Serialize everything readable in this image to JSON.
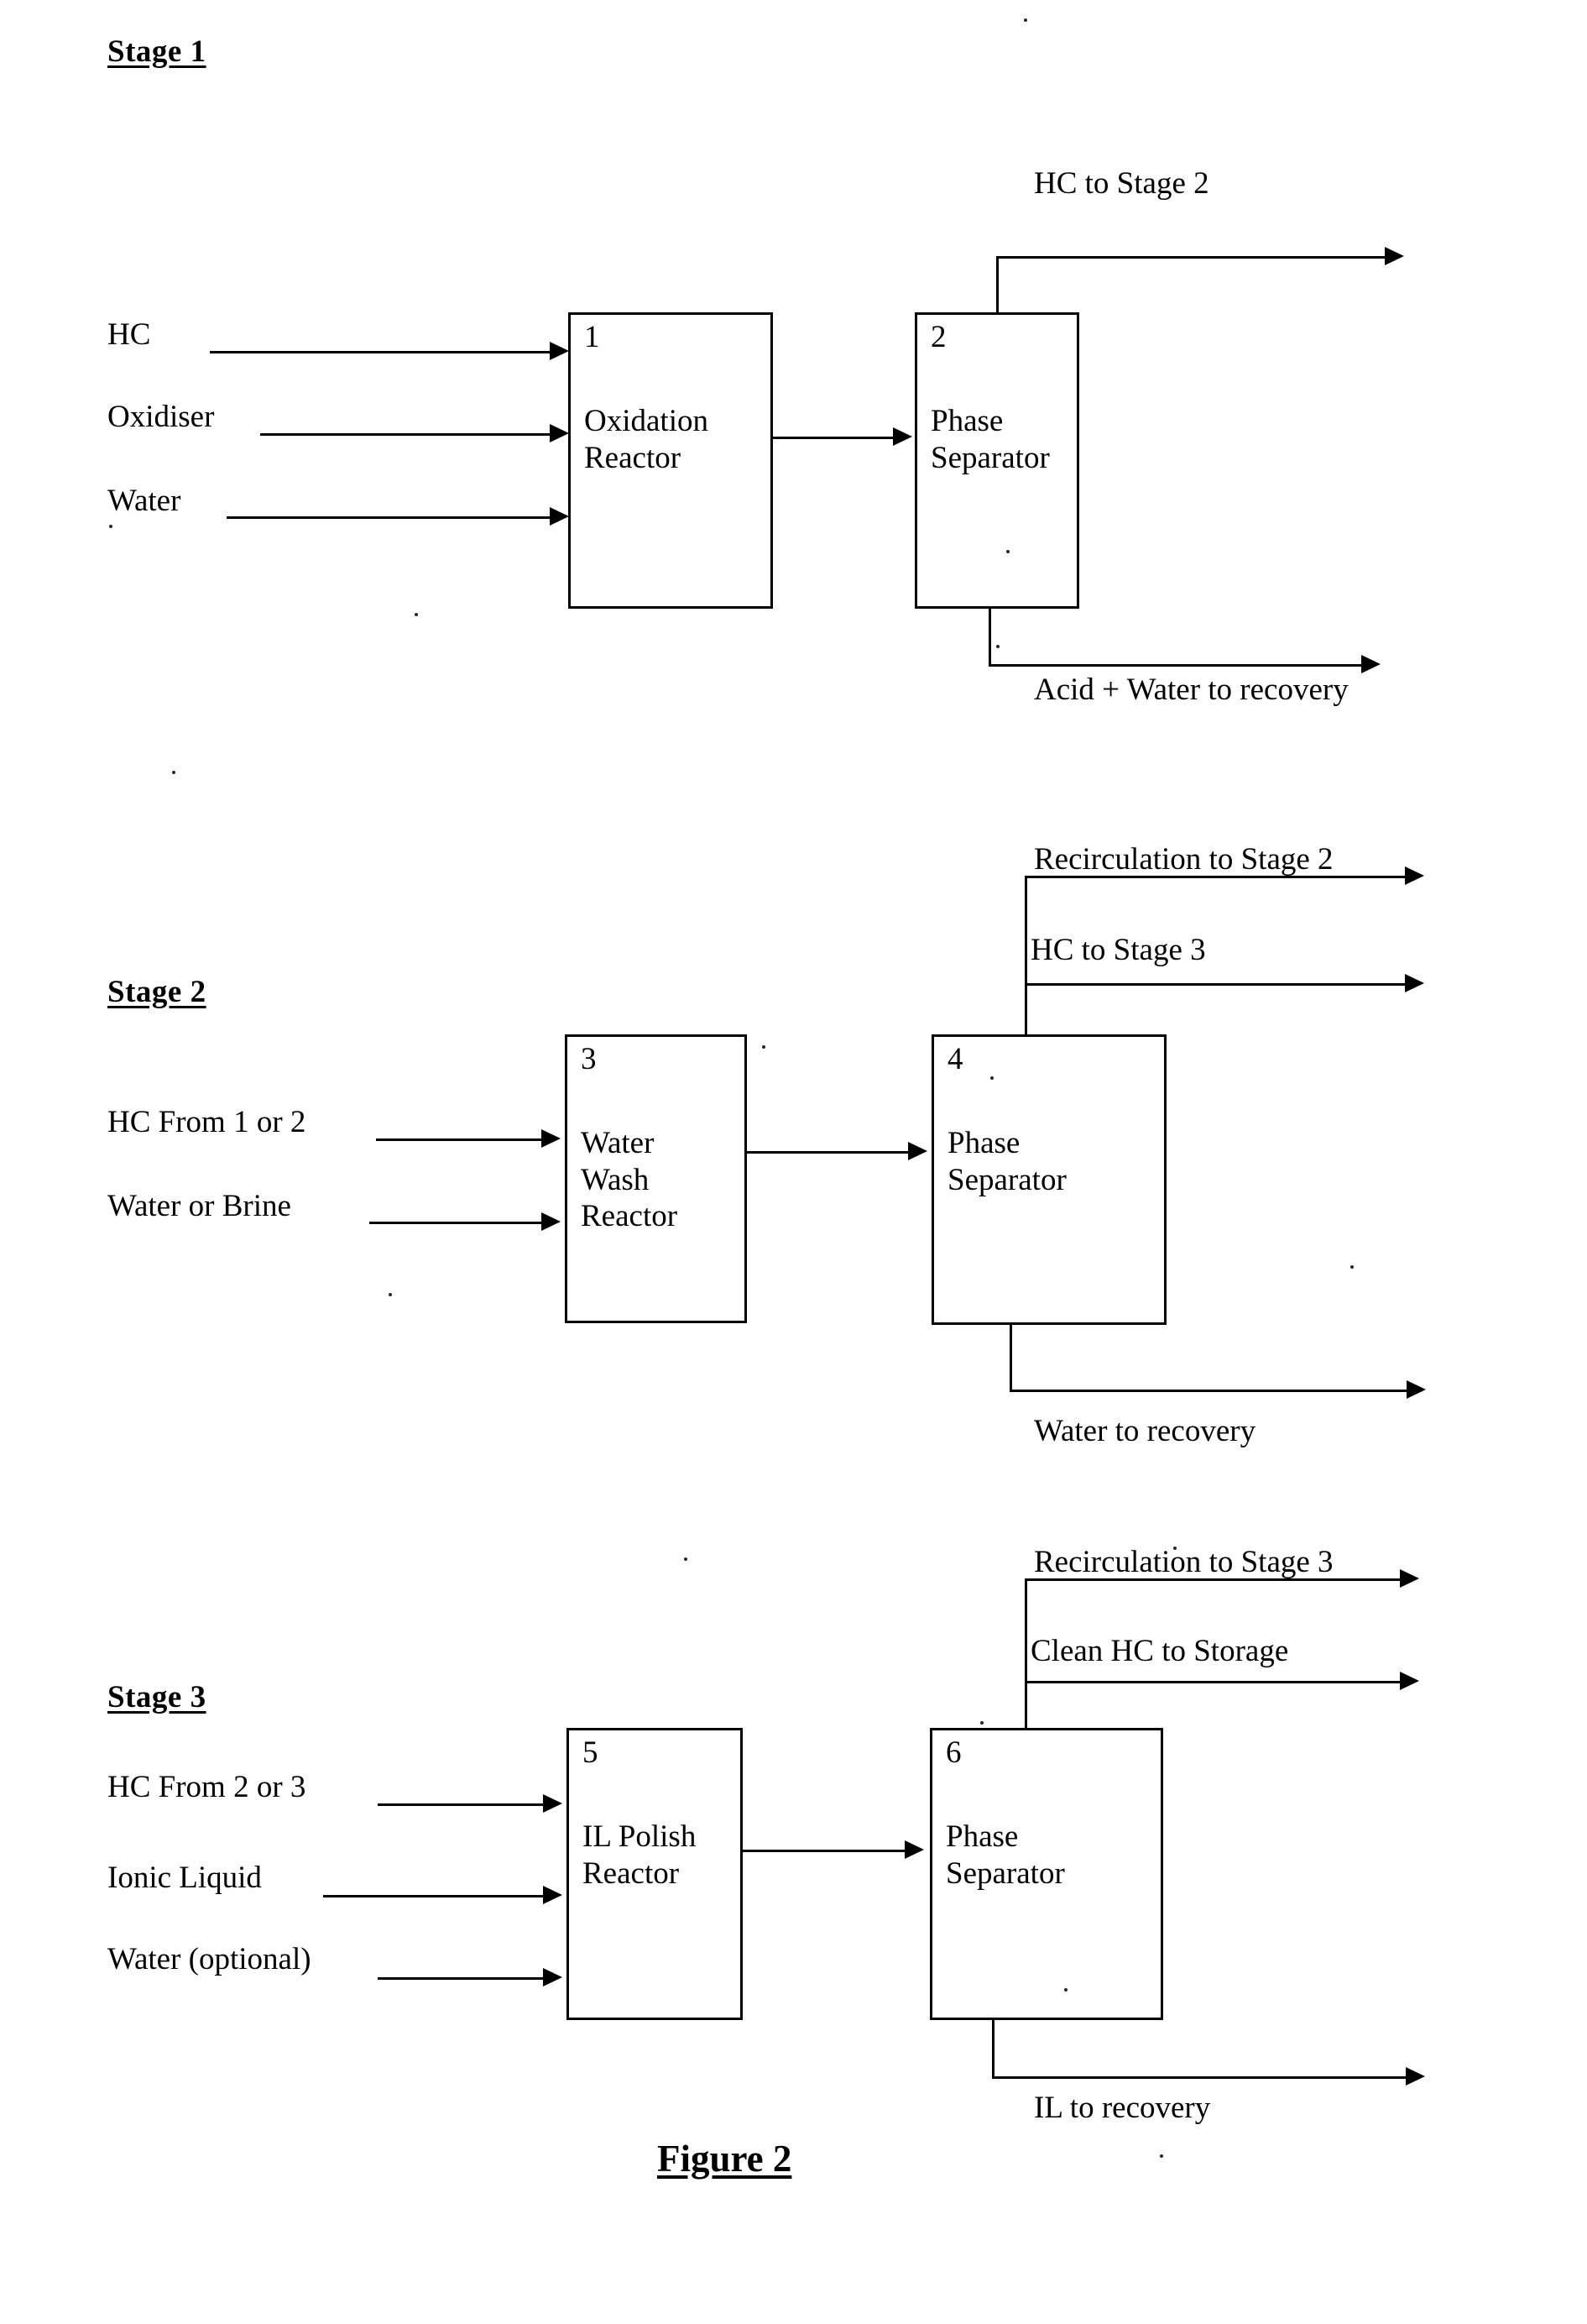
{
  "figure": {
    "caption": "Figure 2"
  },
  "stages": [
    {
      "id": "stage-1",
      "title": "Stage 1",
      "inputs": [
        "HC",
        "Oxidiser",
        "Water"
      ],
      "units": [
        {
          "number": "1",
          "name": "Oxidation\nReactor"
        },
        {
          "number": "2",
          "name": "Phase\nSeparator"
        }
      ],
      "outputs": [
        "HC to Stage 2",
        "Acid + Water to recovery"
      ]
    },
    {
      "id": "stage-2",
      "title": "Stage 2",
      "inputs": [
        "HC From 1 or 2",
        "Water or Brine"
      ],
      "units": [
        {
          "number": "3",
          "name": "Water\nWash\nReactor"
        },
        {
          "number": "4",
          "name": "Phase\nSeparator"
        }
      ],
      "outputs": [
        "Recirculation to Stage 2",
        "HC to Stage 3",
        "Water to recovery"
      ]
    },
    {
      "id": "stage-3",
      "title": "Stage 3",
      "inputs": [
        "HC From 2 or 3",
        "Ionic Liquid",
        "Water (optional)"
      ],
      "units": [
        {
          "number": "5",
          "name": "IL Polish\nReactor"
        },
        {
          "number": "6",
          "name": "Phase\nSeparator"
        }
      ],
      "outputs": [
        "Recirculation to Stage 3",
        "Clean HC to Storage",
        "IL to recovery"
      ]
    }
  ]
}
